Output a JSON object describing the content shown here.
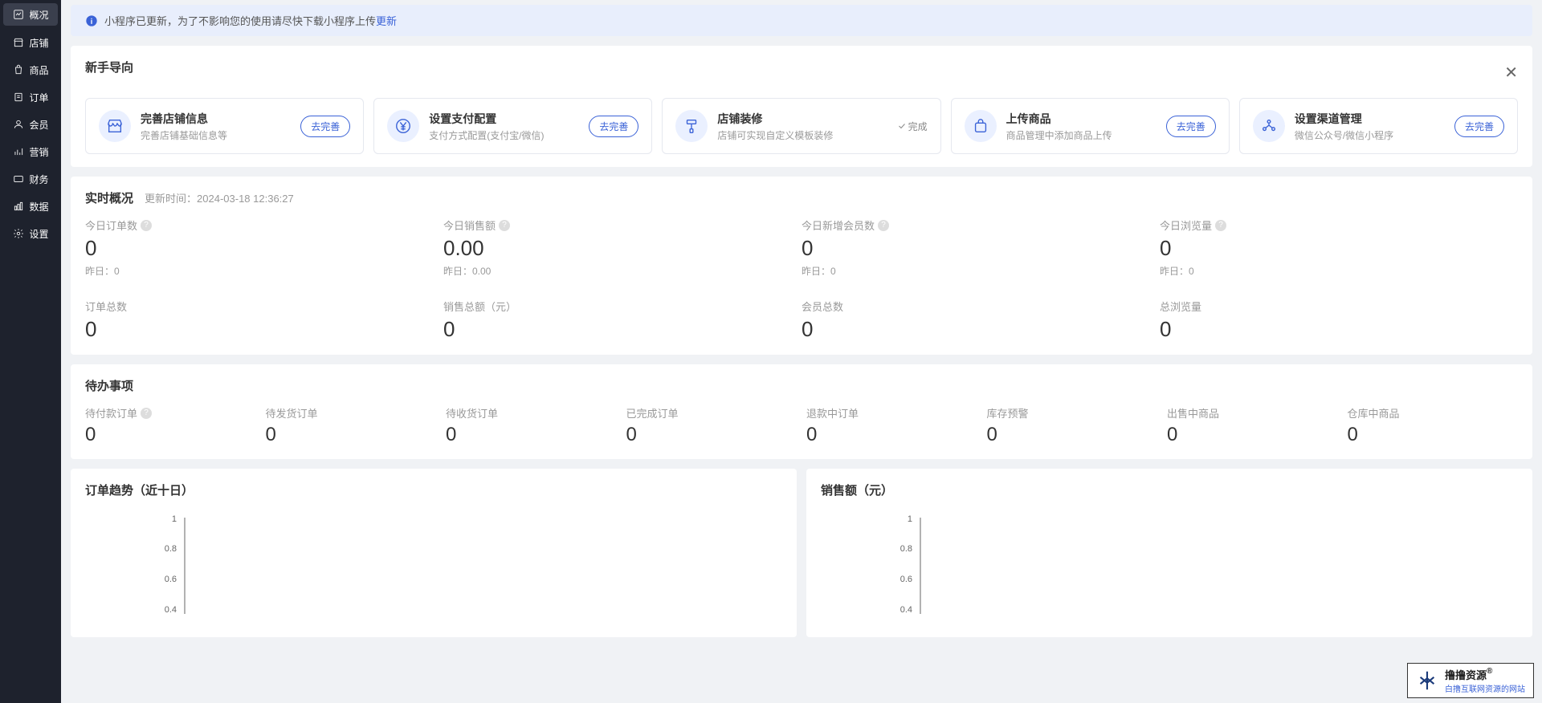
{
  "sidebar": {
    "items": [
      {
        "label": "概况"
      },
      {
        "label": "店铺"
      },
      {
        "label": "商品"
      },
      {
        "label": "订单"
      },
      {
        "label": "会员"
      },
      {
        "label": "营销"
      },
      {
        "label": "财务"
      },
      {
        "label": "数据"
      },
      {
        "label": "设置"
      }
    ]
  },
  "alert": {
    "text": "小程序已更新，为了不影响您的使用请尽快下载小程序上传",
    "link": "更新"
  },
  "guide": {
    "title": "新手导向",
    "cards": [
      {
        "title": "完善店铺信息",
        "sub": "完善店铺基础信息等",
        "action": "去完善"
      },
      {
        "title": "设置支付配置",
        "sub": "支付方式配置(支付宝/微信)",
        "action": "去完善"
      },
      {
        "title": "店铺装修",
        "sub": "店铺可实现自定义模板装修",
        "done": "完成"
      },
      {
        "title": "上传商品",
        "sub": "商品管理中添加商品上传",
        "action": "去完善"
      },
      {
        "title": "设置渠道管理",
        "sub": "微信公众号/微信小程序",
        "action": "去完善"
      }
    ]
  },
  "realtime": {
    "title": "实时概况",
    "update_prefix": "更新时间：",
    "update_time": "2024-03-18 12:36:27",
    "yest_prefix": "昨日：",
    "row1": [
      {
        "label": "今日订单数",
        "value": "0",
        "yest": "0",
        "help": true
      },
      {
        "label": "今日销售额",
        "value": "0.00",
        "yest": "0.00",
        "help": true
      },
      {
        "label": "今日新增会员数",
        "value": "0",
        "yest": "0",
        "help": true
      },
      {
        "label": "今日浏览量",
        "value": "0",
        "yest": "0",
        "help": true
      }
    ],
    "row2": [
      {
        "label": "订单总数",
        "value": "0"
      },
      {
        "label": "销售总额（元）",
        "value": "0"
      },
      {
        "label": "会员总数",
        "value": "0"
      },
      {
        "label": "总浏览量",
        "value": "0"
      }
    ]
  },
  "todo": {
    "title": "待办事项",
    "items": [
      {
        "label": "待付款订单",
        "value": "0",
        "help": true
      },
      {
        "label": "待发货订单",
        "value": "0"
      },
      {
        "label": "待收货订单",
        "value": "0"
      },
      {
        "label": "已完成订单",
        "value": "0"
      },
      {
        "label": "退款中订单",
        "value": "0"
      },
      {
        "label": "库存预警",
        "value": "0"
      },
      {
        "label": "出售中商品",
        "value": "0"
      },
      {
        "label": "仓库中商品",
        "value": "0"
      }
    ]
  },
  "charts": {
    "left_title": "订单趋势（近十日）",
    "right_title": "销售额（元）"
  },
  "chart_data": [
    {
      "type": "line",
      "title": "订单趋势（近十日）",
      "y_ticks": [
        0.4,
        0.6,
        0.8,
        1
      ],
      "ylim": [
        0.4,
        1
      ],
      "series": [
        {
          "name": "orders",
          "values": []
        }
      ]
    },
    {
      "type": "line",
      "title": "销售额（元）",
      "y_ticks": [
        0.4,
        0.6,
        0.8,
        1
      ],
      "ylim": [
        0.4,
        1
      ],
      "series": [
        {
          "name": "sales",
          "values": []
        }
      ]
    }
  ],
  "watermark": {
    "name": "撸撸资源",
    "reg": "®",
    "tagline": "白撸互联网资源的网站"
  }
}
